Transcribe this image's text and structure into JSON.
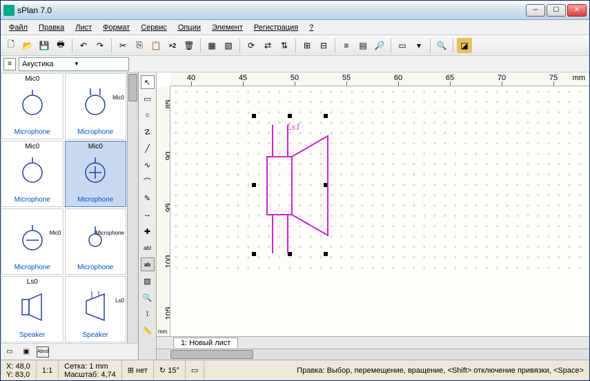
{
  "window": {
    "title": "sPlan 7.0"
  },
  "menu": [
    "Файл",
    "Правка",
    "Лист",
    "Формат",
    "Сервис",
    "Опции",
    "Элемент",
    "Регистрация",
    "?"
  ],
  "category": {
    "value": "Акустика"
  },
  "ruler": {
    "h_ticks": [
      "40",
      "45",
      "50",
      "55",
      "60",
      "65",
      "70",
      "75"
    ],
    "h_unit": "mm",
    "v_ticks": [
      "85",
      "90",
      "95",
      "100",
      "105"
    ],
    "v_unit": "mm"
  },
  "library": {
    "cells": [
      {
        "tag": "Mic0",
        "name": "Microphone",
        "sym": "mic-plain",
        "tagpos": "top"
      },
      {
        "tag": "Mic0",
        "name": "Microphone",
        "sym": "mic-2line",
        "tagpos": "right"
      },
      {
        "tag": "Mic0",
        "name": "Microphone",
        "sym": "mic-1line",
        "tagpos": "top"
      },
      {
        "tag": "Mic0",
        "name": "Microphone",
        "sym": "mic-cross",
        "tagpos": "top",
        "selected": true
      },
      {
        "tag": "Mic0",
        "name": "Microphone",
        "sym": "mic-minus",
        "tagpos": "right"
      },
      {
        "tag": "Microphone",
        "name": "Microphone",
        "sym": "mic-small",
        "tagpos": "right"
      },
      {
        "tag": "Ls0",
        "name": "Speaker",
        "sym": "spk-1",
        "tagpos": "top"
      },
      {
        "tag": "Ls0",
        "name": "Speaker",
        "sym": "spk-2",
        "tagpos": "right"
      }
    ]
  },
  "toolbar_x2": "×2",
  "canvas": {
    "label": "Ls1"
  },
  "tab": {
    "label": "1: Новый лист"
  },
  "status": {
    "x": "X: 48,0",
    "y": "Y: 83,0",
    "ratio": "1:1",
    "setka_lbl": "Сетка:",
    "setka_val": "1 mm",
    "masht_lbl": "Масштаб:",
    "masht_val": "4,74",
    "snap1": "нет",
    "snap2": "15°",
    "hint": "Правка: Выбор, перемещение, вращение, <Shift> отключение привязки, <Space>"
  }
}
